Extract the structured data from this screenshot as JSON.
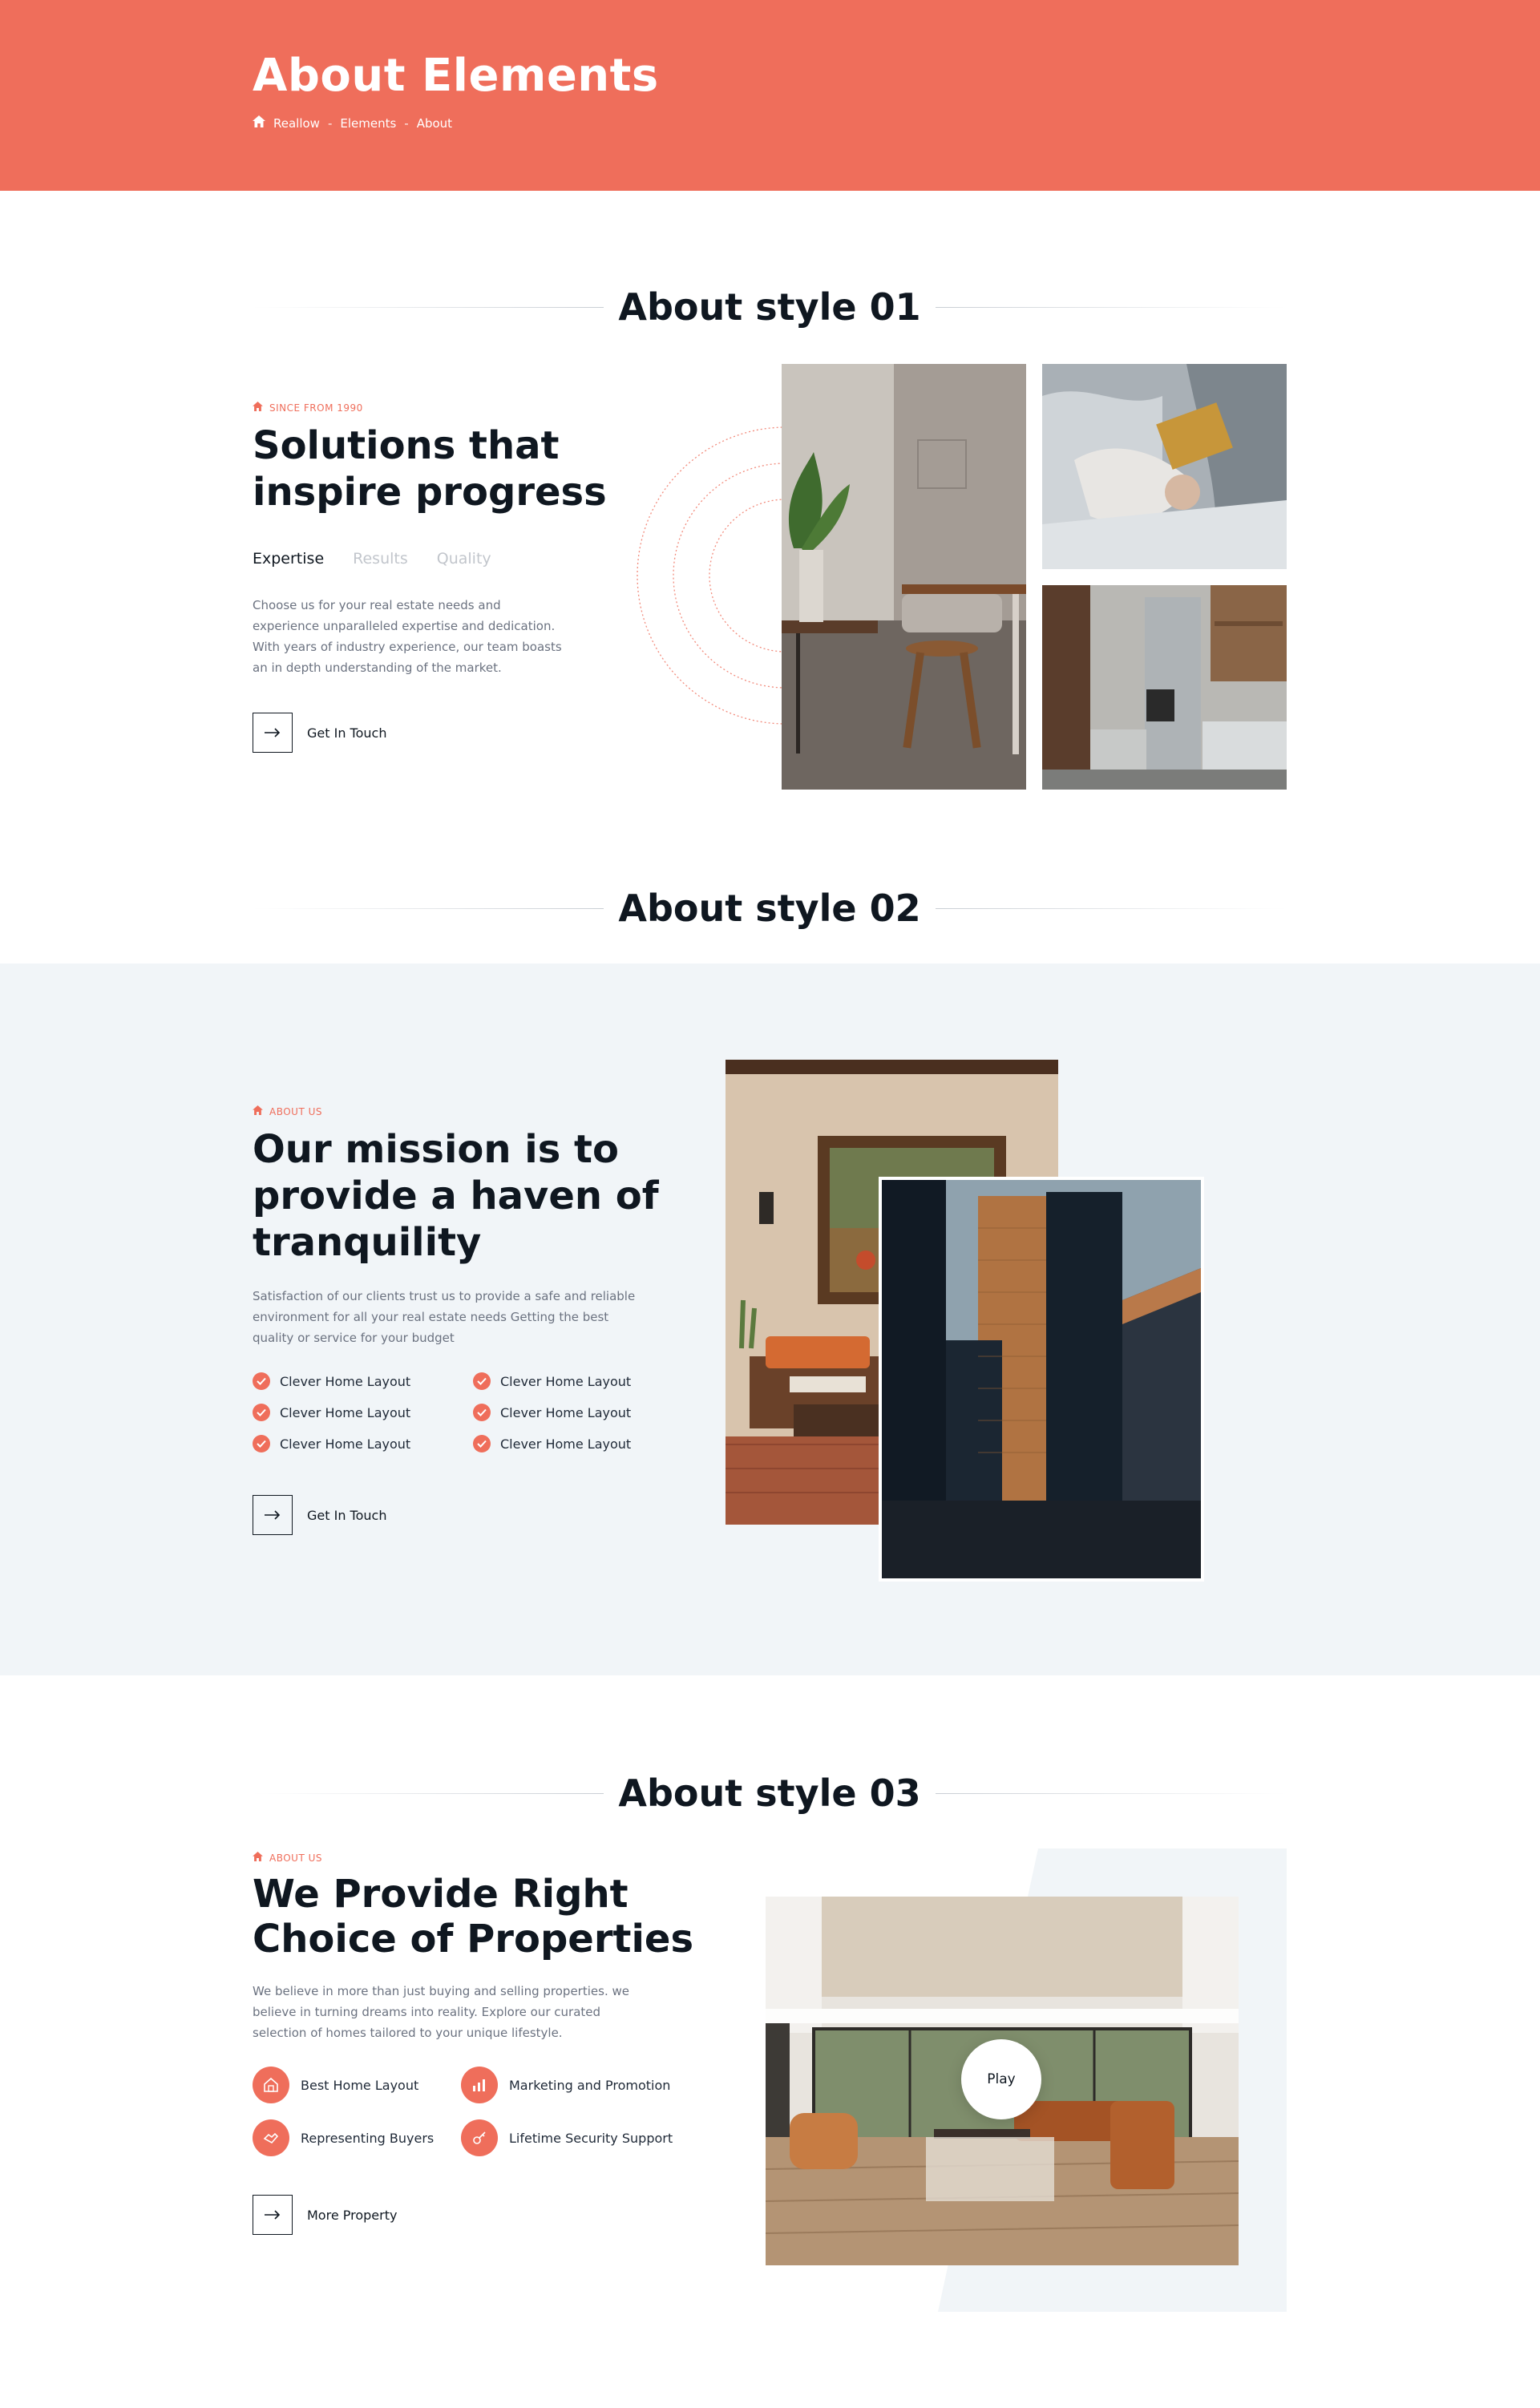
{
  "colors": {
    "accent": "#ef6e5b",
    "dark": "#0f1720",
    "band": "#f1f5f8",
    "muted": "#6b7280"
  },
  "header": {
    "title": "About Elements",
    "breadcrumb": [
      "Reallow",
      "Elements",
      "About"
    ]
  },
  "style01": {
    "section_title": "About style 01",
    "eyebrow": "SINCE FROM 1990",
    "heading_line1": "Solutions that",
    "heading_line2": "inspire progress",
    "tabs": [
      {
        "label": "Expertise",
        "active": true
      },
      {
        "label": "Results",
        "active": false
      },
      {
        "label": "Quality",
        "active": false
      }
    ],
    "paragraph_lines": [
      "Choose us for your real estate needs and",
      "experience unparalleled expertise and dedication.",
      "With years of industry experience, our team boasts",
      "an in depth understanding of the market."
    ],
    "button_label": "Get In Touch"
  },
  "style02": {
    "section_title": "About style 02",
    "eyebrow": "ABOUT US",
    "heading_lines": [
      "Our mission is to",
      "provide a haven of",
      "tranquility"
    ],
    "paragraph_lines": [
      "Satisfaction of our clients trust us to provide a safe and reliable",
      "environment for all your real estate needs Getting the best",
      "quality or service for your budget"
    ],
    "checklist": [
      "Clever Home Layout",
      "Clever Home Layout",
      "Clever Home Layout",
      "Clever Home Layout",
      "Clever Home Layout",
      "Clever Home Layout"
    ],
    "button_label": "Get In Touch"
  },
  "style03": {
    "section_title": "About style 03",
    "eyebrow": "ABOUT US",
    "heading_lines": [
      "We Provide Right",
      "Choice of Properties"
    ],
    "paragraph_lines": [
      "We believe in more than just buying and selling properties. we",
      "believe in turning dreams into reality. Explore our curated",
      "selection of homes tailored to your unique lifestyle."
    ],
    "features": [
      "Best Home Layout",
      "Marketing and Promotion",
      "Representing Buyers",
      "Lifetime Security Support"
    ],
    "button_label": "More Property",
    "play_label": "Play"
  }
}
